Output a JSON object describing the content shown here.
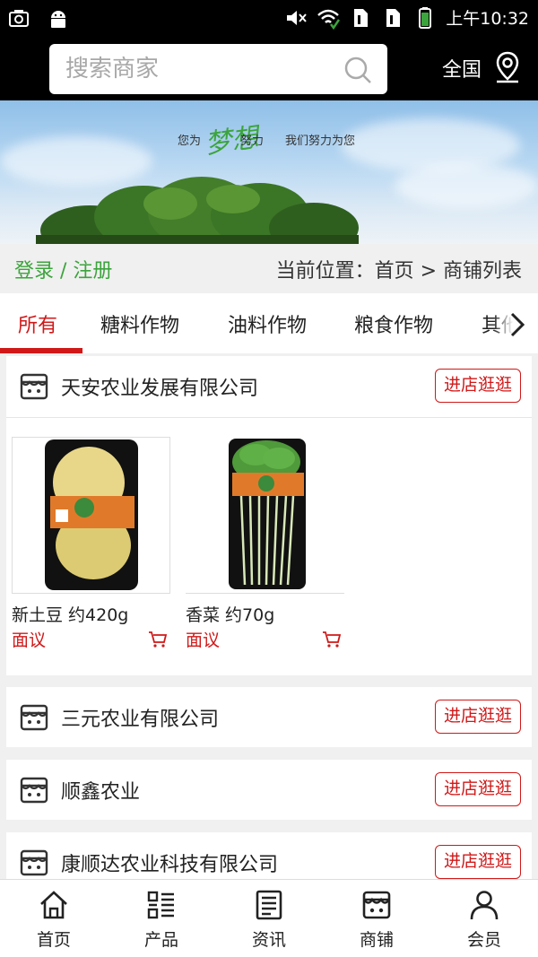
{
  "status_bar": {
    "time": "上午10:32"
  },
  "header": {
    "search_placeholder": "搜索商家",
    "region": "全国"
  },
  "banner": {
    "slogan_left": "您为",
    "slogan_dream": "梦想",
    "slogan_mid": "努力",
    "slogan_right": "我们努力为您"
  },
  "location_bar": {
    "login": "登录 / 注册",
    "breadcrumb": "当前位置：首页 > 商铺列表"
  },
  "tabs": [
    {
      "label": "所有",
      "active": true
    },
    {
      "label": "糖料作物"
    },
    {
      "label": "油料作物"
    },
    {
      "label": "粮食作物"
    },
    {
      "label": "其他"
    }
  ],
  "stores": [
    {
      "name": "天安农业发展有限公司",
      "visit_label": "进店逛逛",
      "products": [
        {
          "name": "新土豆 约420g",
          "price": "面议"
        },
        {
          "name": "香菜 约70g",
          "price": "面议"
        }
      ]
    },
    {
      "name": "三元农业有限公司",
      "visit_label": "进店逛逛"
    },
    {
      "name": "顺鑫农业",
      "visit_label": "进店逛逛"
    },
    {
      "name": "康顺达农业科技有限公司",
      "visit_label": "进店逛逛"
    }
  ],
  "bottom_nav": [
    {
      "label": "首页",
      "icon": "home-icon"
    },
    {
      "label": "产品",
      "icon": "grid-list-icon"
    },
    {
      "label": "资讯",
      "icon": "news-icon"
    },
    {
      "label": "商铺",
      "icon": "shop-icon"
    },
    {
      "label": "会员",
      "icon": "user-icon"
    }
  ],
  "colors": {
    "accent": "#d01818",
    "green": "#3ca43c",
    "header_bg": "#000000"
  }
}
